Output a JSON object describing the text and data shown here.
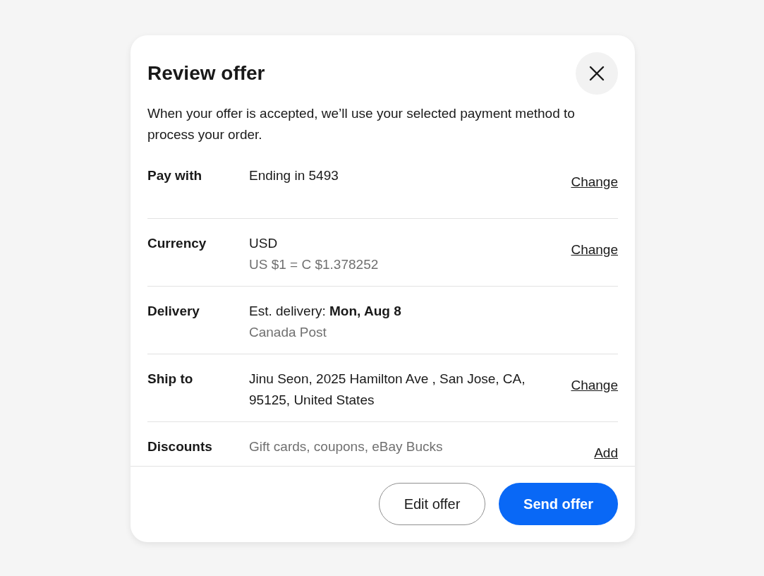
{
  "dialog": {
    "title": "Review offer",
    "description": "When your offer is accepted, we’ll use your selected payment method to process your order.",
    "rows": [
      {
        "label": "Pay with",
        "lines": [
          {
            "text": "Ending in 5493",
            "muted": false
          }
        ],
        "action": "Change"
      },
      {
        "label": "Currency",
        "lines": [
          {
            "text": "USD",
            "muted": false
          },
          {
            "text": "US $1 = C $1.378252",
            "muted": true
          }
        ],
        "action": "Change"
      },
      {
        "label": "Delivery",
        "lines": [
          {
            "text": "Est. delivery: **Mon, Aug 8**",
            "muted": false
          },
          {
            "text": "Canada Post",
            "muted": true
          }
        ]
      },
      {
        "label": "Ship to",
        "lines": [
          {
            "text": "Jinu Seon, 2025 Hamilton Ave , San Jose, CA, 95125, United States",
            "muted": false
          }
        ],
        "action": "Change"
      },
      {
        "label": "Discounts",
        "lines": [
          {
            "text": "Gift cards, coupons, eBay Bucks",
            "muted": true
          }
        ],
        "action": "Add"
      }
    ],
    "buttons": [
      {
        "label": "Edit offer",
        "kind": "secondary"
      },
      {
        "label": "Send offer",
        "kind": "primary"
      }
    ]
  }
}
